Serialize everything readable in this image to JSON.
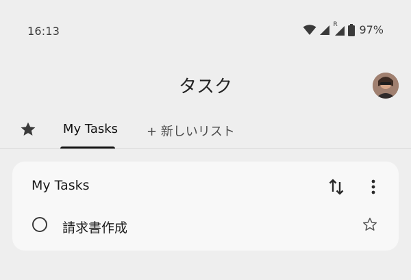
{
  "status_bar": {
    "time": "16:13",
    "network_indicator": "R",
    "battery": "97%"
  },
  "header": {
    "title": "タスク",
    "avatar_icon": "user-avatar"
  },
  "tabs": {
    "starred_icon": "star-filled-icon",
    "active_tab": "My Tasks",
    "new_list": "+ 新しいリスト"
  },
  "list_card": {
    "title": "My Tasks",
    "sort_icon": "sort-arrows-icon",
    "more_icon": "more-vert-icon",
    "tasks": [
      {
        "title": "請求書作成",
        "completed": false,
        "starred": false
      }
    ]
  },
  "colors": {
    "background": "#eeeeee",
    "card": "#f8f8f8",
    "text": "#1f1f1f",
    "active_tab_indicator": "#111111"
  }
}
